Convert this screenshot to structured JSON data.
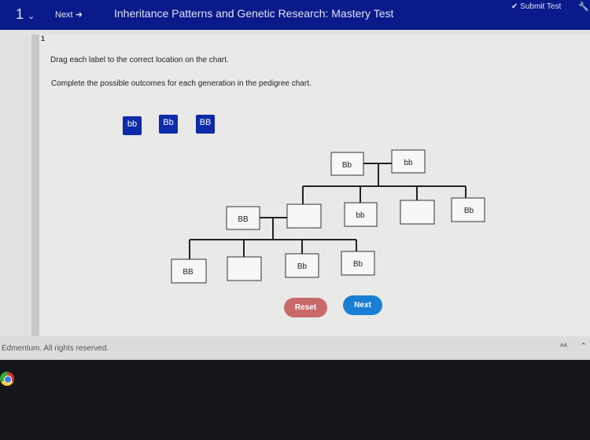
{
  "header": {
    "question_number": "1",
    "next_label": "Next",
    "title": "Inheritance Patterns and Genetic Research: Mastery Test",
    "submit_label": "Submit Test"
  },
  "question": {
    "number": "1",
    "instruction": "Drag each label to the correct location on the chart.",
    "prompt": "Complete the possible outcomes for each generation in the pedigree chart."
  },
  "labels": [
    "bb",
    "Bb",
    "BB"
  ],
  "pedigree": {
    "generation1": [
      "Bb",
      "bb"
    ],
    "generation2": [
      "BB",
      "",
      "bb",
      "",
      "Bb"
    ],
    "generation3": [
      "BB",
      "",
      "Bb",
      "Bb"
    ]
  },
  "buttons": {
    "reset": "Reset",
    "next": "Next"
  },
  "footer": {
    "copyright": "Edmentum. All rights reserved."
  },
  "colors": {
    "header": "#0b1a8a",
    "label": "#0d2aa8",
    "reset": "#c96a6a",
    "next": "#1a7fd4"
  }
}
